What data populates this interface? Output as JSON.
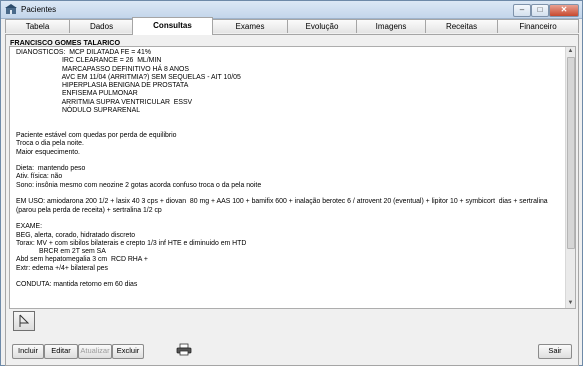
{
  "window": {
    "title": "Pacientes"
  },
  "tabs": [
    {
      "label": "Tabela"
    },
    {
      "label": "Dados"
    },
    {
      "label": "Consultas"
    },
    {
      "label": "Exames"
    },
    {
      "label": "Evolução"
    },
    {
      "label": "Imagens"
    },
    {
      "label": "Receitas"
    },
    {
      "label": "Financeiro"
    }
  ],
  "active_tab": "Consultas",
  "patient": {
    "name": "FRANCISCO GOMES TALARICO"
  },
  "consulta_lines": [
    "DIANÓSTICOS:  MCP DILATADA FE = 41%",
    "                        IRC CLEARANCE = 26  ML/MIN",
    "                        MARCAPASSO DEFINITIVO HÁ 8 ANOS",
    "                        AVC EM 11/04 (ARRITMIA?) SEM SEQUELAS - AIT 10/05",
    "                        HIPERPLASIA BENIGNA DE PROSTATA",
    "                        ENFISEMA PULMONAR",
    "                        ARRITMIA SUPRA VENTRICULAR  ESSV",
    "                        NÓDULO SUPRARENAL",
    "",
    "",
    "Paciente estável com quedas por perda de equilibrio",
    "Troca o dia pela noite.",
    "Maior esquecimento.",
    "",
    "Dieta:  mantendo peso",
    "Ativ. física: não",
    "Sono: insônia mesmo com neozine 2 gotas acorda confuso troca o da pela noite",
    "",
    "EM USO: amiodarona 200 1/2 + lasix 40 3 cps + diovan  80 mg + AAS 100 + bamifix 600 + inalação berotec 6 / atrovent 20 (eventual) + lipitor 10 + symbicort  dias + sertralina",
    "(parou pela perda de receita) + sertralina 1/2 cp",
    "",
    "EXAME:",
    "BEG, alerta, corado, hidratado discreto",
    "Torax: MV + com sibilos bilaterais e crepto 1/3 inf HTE e diminuido em HTD",
    "            BRCR em 2T sem SA",
    "Abd sem hepatomegalia 3 cm  RCD RHA +",
    "Extr: edema +/4+ bilateral pes",
    "",
    "CONDUTA: mantida retorno em 60 dias"
  ],
  "buttons": {
    "incluir": "Incluir",
    "editar": "Editar",
    "atualizar": "Atualizar",
    "excluir": "Excluir",
    "sair": "Sair"
  },
  "icons": {
    "app": "app-icon",
    "print": "printer-icon",
    "flag": "flag-icon"
  }
}
